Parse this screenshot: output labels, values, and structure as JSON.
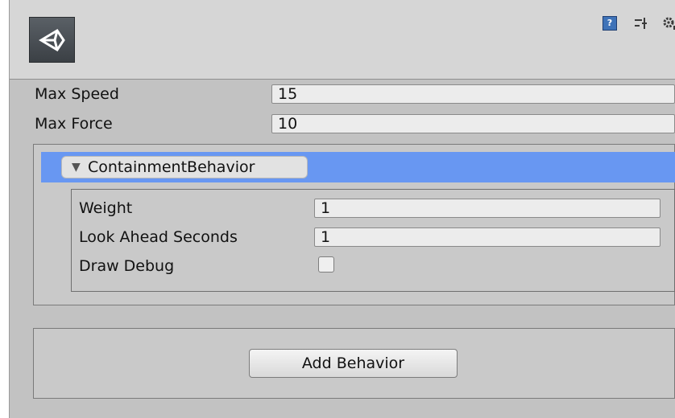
{
  "header": {
    "icons": [
      "unity-logo-icon",
      "help-icon",
      "preset-icon",
      "gear-icon"
    ],
    "help_glyph": "?"
  },
  "properties": [
    {
      "label": "Max Speed",
      "value": "15"
    },
    {
      "label": "Max Force",
      "value": "10"
    }
  ],
  "behavior": {
    "name": "ContainmentBehavior",
    "fold_glyph": "▼",
    "fields": [
      {
        "label": "Weight",
        "value": "1"
      },
      {
        "label": "Look Ahead Seconds",
        "value": "1"
      }
    ],
    "draw_debug": {
      "label": "Draw Debug",
      "checked": false
    }
  },
  "add_button_label": "Add Behavior",
  "colors": {
    "selection_bar": "#6897f2",
    "panel_bg": "#c2c2c2",
    "field_bg": "#ececec"
  }
}
